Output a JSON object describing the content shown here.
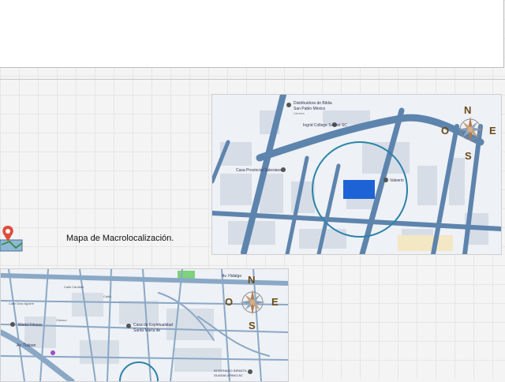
{
  "document": {
    "caption": "Mapa de Macrolocalización.",
    "compass": {
      "north": "N",
      "south": "S",
      "east": "E",
      "west": "O"
    },
    "map_small": {
      "labels": {
        "distribuidora_line1": "Distribuidora de Biblia",
        "distribuidora_line2": "San Pablo México",
        "distribuidora_line3": "Librería",
        "school": "Ingrid College School SC",
        "casa": "Casa Provincial Salesiana",
        "valverio": "Valverio"
      }
    },
    "map_large": {
      "labels": {
        "street_hidalgo": "Av. Hidalgo",
        "wtmfitness": "World Fitness",
        "casa_esp_line1": "Casa de Espiritualidad",
        "casa_esp_line2": "Santa María de",
        "internado_line1": "INTERNADO INFANTIL",
        "internado_line2": "GUADALUPANO AC",
        "street_tlalpan": "Av. Tlalpan",
        "street_diaz": "Calle Díaz Aguirre",
        "street_candido": "Calle Cándido",
        "street_cadiz": "Cádiz",
        "street_chusco": "Chusco"
      }
    },
    "colors": {
      "road": "#5d84ad",
      "highlight_block": "#1e63d6",
      "circle": "#2b83a8",
      "block": "#d7dde6",
      "compass_north": "#6b4a19"
    }
  }
}
